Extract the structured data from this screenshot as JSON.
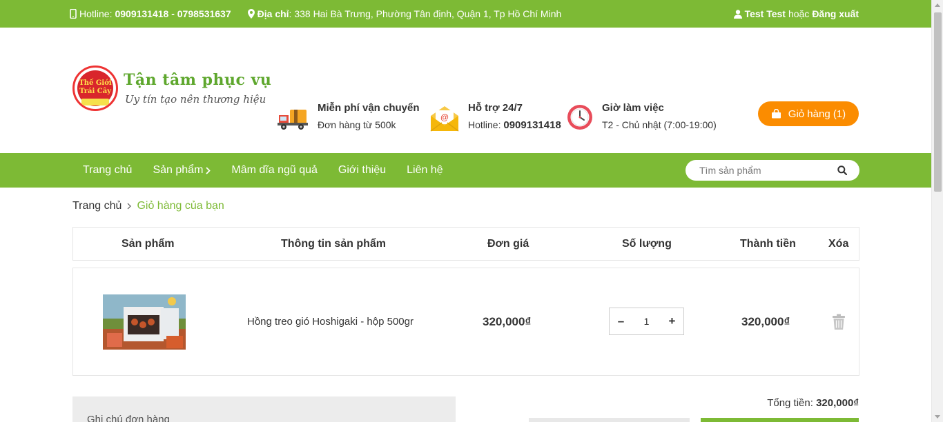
{
  "topbar": {
    "hotline_label": "Hotline:",
    "hotline_value": "0909131418 - 0798531637",
    "address_label": "Địa chỉ",
    "address_value": ": 338 Hai Bà Trưng, Phường Tân định, Quận 1, Tp Hồ Chí Minh",
    "user_name": "Test Test",
    "or_text": "hoặc",
    "logout_label": "Đăng xuất"
  },
  "header": {
    "logo_line1": "Thế Giới",
    "logo_line2": "Trái Cây",
    "slogan": "Tận tâm phục vụ",
    "subslogan": "Uy tín tạo nên thương hiệu",
    "features": [
      {
        "title": "Miễn phí vận chuyển",
        "sub": "Đơn hàng từ 500k",
        "icon": "truck-icon"
      },
      {
        "title": "Hỗ trợ 24/7",
        "sub_label": "Hotline:",
        "sub_value": "0909131418",
        "icon": "mail-icon"
      },
      {
        "title": "Giờ làm việc",
        "sub": "T2 - Chủ nhật (7:00-19:00)",
        "icon": "clock-icon"
      }
    ],
    "cart_button": "Giỏ hàng (1)"
  },
  "nav": {
    "items": [
      "Trang chủ",
      "Sản phẩm",
      "Mâm dĩa ngũ quả",
      "Giới thiệu",
      "Liên hệ"
    ],
    "search_placeholder": "Tìm sản phẩm"
  },
  "breadcrumb": {
    "home": "Trang chủ",
    "current": "Giỏ hàng của bạn"
  },
  "cart": {
    "columns": [
      "Sản phẩm",
      "Thông tin sản phẩm",
      "Đơn giá",
      "Số lượng",
      "Thành tiền",
      "Xóa"
    ],
    "items": [
      {
        "name": "Hồng treo gió Hoshigaki - hộp 500gr",
        "price": "320,000₫",
        "quantity": "1",
        "subtotal": "320,000₫"
      }
    ],
    "qty_minus": "–",
    "qty_plus": "+",
    "total_label": "Tổng tiền:",
    "total_value": "320,000₫",
    "note_label": "Ghi chú đơn hàng"
  },
  "colors": {
    "brand_green": "#7dba35",
    "cart_orange": "#fb8c00"
  }
}
